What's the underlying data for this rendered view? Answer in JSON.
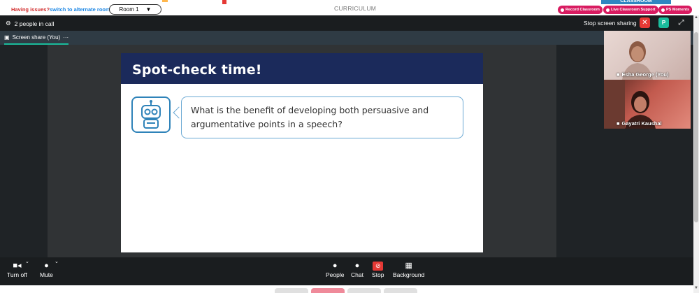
{
  "topbar": {
    "issues_label": "Having issues?",
    "switch_label": "switch to alternate room",
    "room_value": "Room 1",
    "curriculum_label": "CURRICULUM",
    "classroom_label": "CLASSROOM",
    "buttons": {
      "record": "Record Classroom",
      "support": "Live Classroom Support",
      "moments": "PS Moments"
    },
    "accent_color": "#d81b60"
  },
  "call": {
    "people_count": "2 people in call",
    "stop_sharing": "Stop screen sharing",
    "share_tab": "Screen share (You)",
    "p_badge": "P"
  },
  "slide": {
    "title": "Spot-check time!",
    "question": "What is the benefit of developing both persuasive and argumentative points in a speech?",
    "header_color": "#1b2a5b"
  },
  "participants": [
    {
      "name": "Esha George (You)"
    },
    {
      "name": "Gayatri Kaushal"
    }
  ],
  "controls": {
    "turn_off": "Turn off",
    "mute": "Mute",
    "people": "People",
    "chat": "Chat",
    "stop": "Stop",
    "background": "Background"
  }
}
